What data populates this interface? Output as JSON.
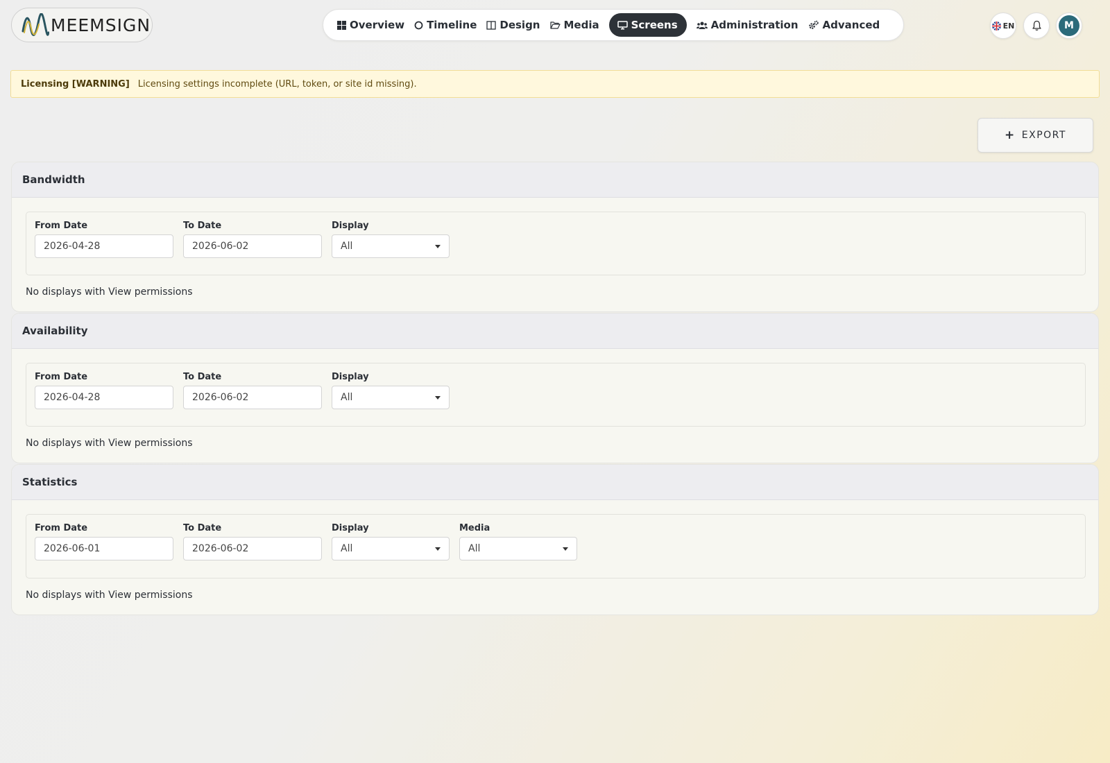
{
  "header": {
    "logo_text": "MEEMSIGN",
    "nav": [
      {
        "label": "Overview",
        "icon": "grid-icon"
      },
      {
        "label": "Timeline",
        "icon": "circle-icon"
      },
      {
        "label": "Design",
        "icon": "columns-icon"
      },
      {
        "label": "Media",
        "icon": "folder-icon"
      },
      {
        "label": "Screens",
        "icon": "monitor-icon",
        "active": true
      },
      {
        "label": "Administration",
        "icon": "users-icon"
      },
      {
        "label": "Advanced",
        "icon": "gears-icon"
      }
    ],
    "language": "EN",
    "avatar_initial": "M"
  },
  "alert": {
    "title": "Licensing [WARNING]",
    "message": "Licensing settings incomplete (URL, token, or site id missing)."
  },
  "export_label": "EXPORT",
  "sections": [
    {
      "title": "Bandwidth",
      "from_label": "From Date",
      "from_value": "2026-04-28",
      "to_label": "To Date",
      "to_value": "2026-06-02",
      "display_label": "Display",
      "display_value": "All",
      "message": "No displays with View permissions"
    },
    {
      "title": "Availability",
      "from_label": "From Date",
      "from_value": "2026-04-28",
      "to_label": "To Date",
      "to_value": "2026-06-02",
      "display_label": "Display",
      "display_value": "All",
      "message": "No displays with View permissions"
    },
    {
      "title": "Statistics",
      "from_label": "From Date",
      "from_value": "2026-06-01",
      "to_label": "To Date",
      "to_value": "2026-06-02",
      "display_label": "Display",
      "display_value": "All",
      "media_label": "Media",
      "media_value": "All",
      "message": "No displays with View permissions"
    }
  ],
  "colors": {
    "nav_active_bg": "#2d3238",
    "alert_bg": "#fff8dd",
    "avatar_bg": "#2b6a7a"
  }
}
